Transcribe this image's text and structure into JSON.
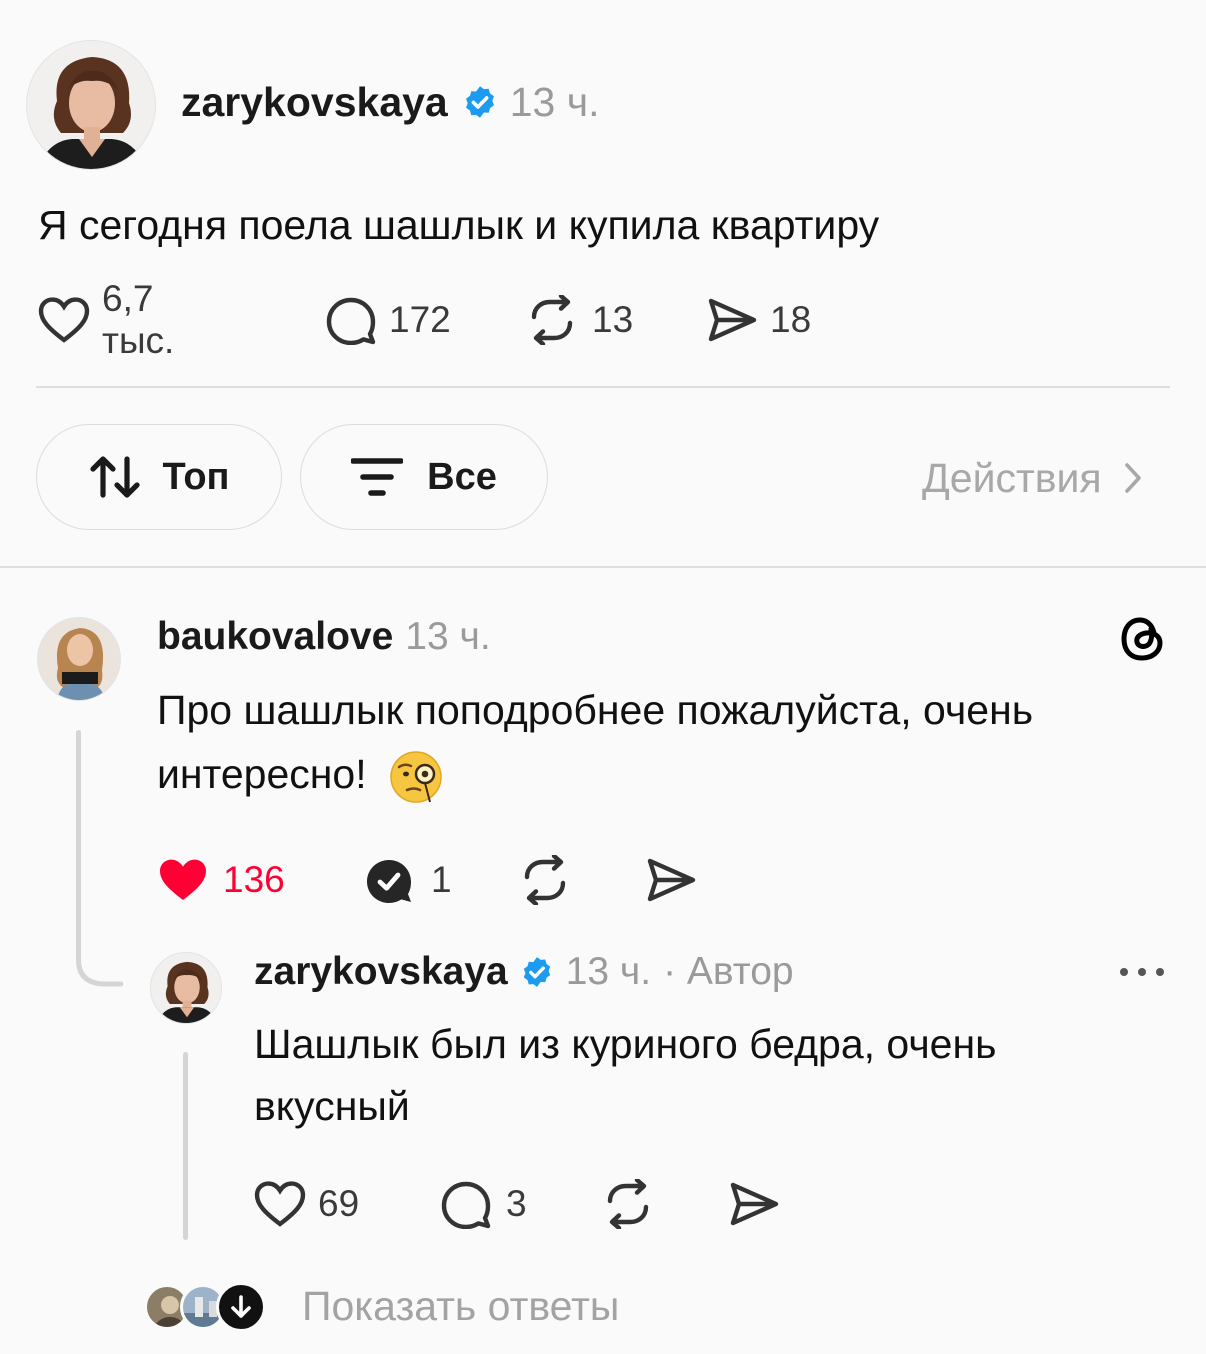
{
  "post": {
    "username": "zarykovskaya",
    "verified": true,
    "time": "13 ч.",
    "text": "Я сегодня поела шашлык и купила квартиру",
    "likes": "6,7 тыс.",
    "comments": "172",
    "reposts": "13",
    "shares": "18"
  },
  "filters": {
    "sort_label": "Топ",
    "filter_label": "Все",
    "actions_label": "Действия"
  },
  "reply1": {
    "username": "baukovalove",
    "time": "13 ч.",
    "text": "Про шашлык поподробнее пожалуйста, очень интересно!",
    "emoji": "🧐",
    "likes": "136",
    "comments": "1",
    "liked": true
  },
  "reply2": {
    "username": "zarykovskaya",
    "verified": true,
    "time": "13 ч.",
    "author_tag": "· Автор",
    "text": "Шашлык был из куриного бедра, очень вкусный",
    "likes": "69",
    "comments": "3"
  },
  "show_replies": {
    "label": "Показать ответы"
  },
  "colors": {
    "verified": "#1d9bf0",
    "like_red": "#ff0034",
    "text": "#1a1a1a",
    "muted": "#9a9a9a"
  }
}
